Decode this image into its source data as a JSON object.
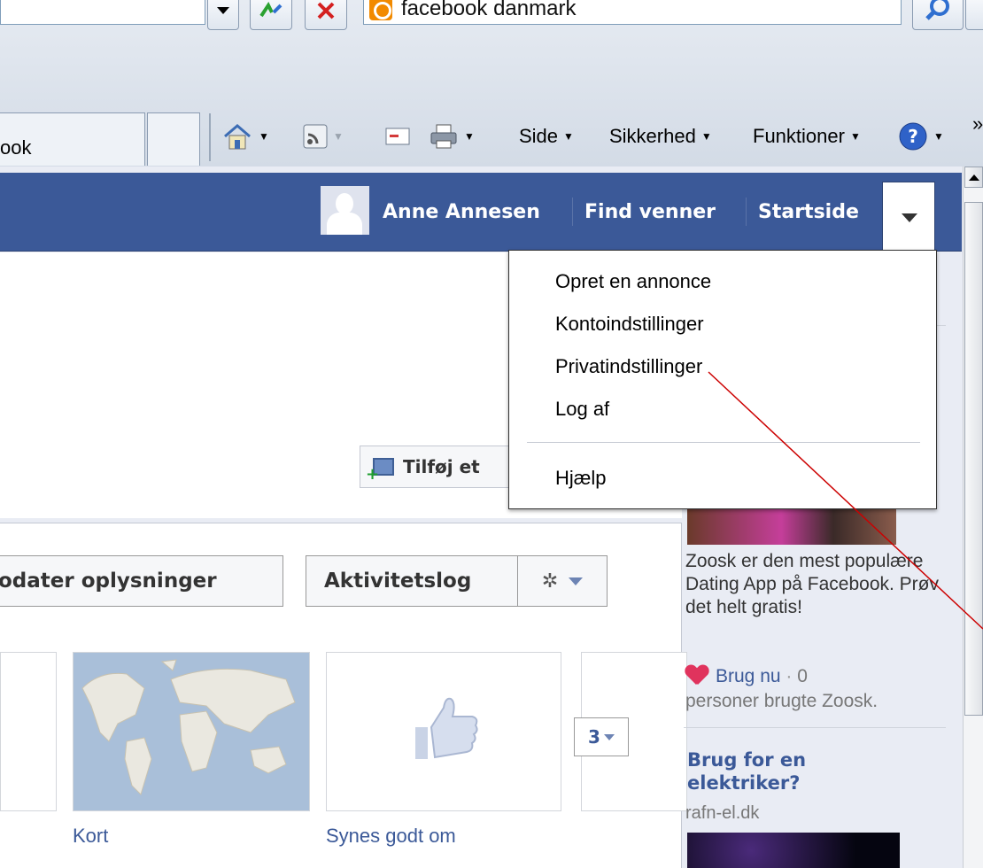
{
  "browser": {
    "search_text": "facebook danmark",
    "tab_label": "ook",
    "commands": {
      "side": "Side",
      "sikkerhed": "Sikkerhed",
      "funktioner": "Funktioner"
    },
    "overflow": "»"
  },
  "fb_header": {
    "user_name": "Anne Annesen",
    "find_friends": "Find venner",
    "home": "Startside"
  },
  "account_menu": {
    "items": [
      "Opret en annonce",
      "Kontoindstillinger",
      "Privatindstillinger",
      "Log af"
    ],
    "help": "Hjælp"
  },
  "profile": {
    "add_photo_label": "Tilføj et",
    "update_info_label": "odater oplysninger",
    "activity_log_label": "Aktivitetslog",
    "tiles": {
      "map_label": "Kort",
      "likes_label": "Synes godt om",
      "more_count": "3"
    }
  },
  "sidebar": {
    "ad1_text": "Zoosk er den mest populære Dating App på Facebook. Prøv det helt gratis!",
    "ad1_cta": "Brug nu",
    "ad1_dot": "·",
    "ad1_count": "0",
    "ad1_social": "personer brugte Zoosk.",
    "ad2_title": "Brug for en elektriker?",
    "ad2_host": "rafn-el.dk"
  },
  "colors": {
    "facebook_blue": "#3b5998",
    "annotation_red": "#cc0000"
  }
}
